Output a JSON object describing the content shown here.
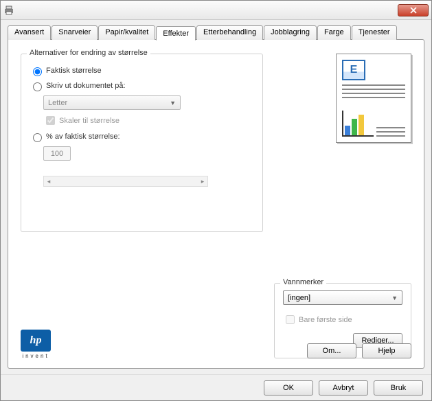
{
  "tabs": {
    "avansert": "Avansert",
    "snarveier": "Snarveier",
    "papir": "Papir/kvalitet",
    "effekter": "Effekter",
    "etterbehandling": "Etterbehandling",
    "jobblagring": "Jobblagring",
    "farge": "Farge",
    "tjenester": "Tjenester"
  },
  "resize_group": {
    "title": "Alternativer for endring av størrelse",
    "actual_size": "Faktisk størrelse",
    "print_on": "Skriv ut dokumentet på:",
    "paper_selected": "Letter",
    "scale_to_size": "Skaler til størrelse",
    "percent_actual": "% av faktisk størrelse:",
    "percent_value": "100"
  },
  "watermark_group": {
    "title": "Vannmerker",
    "selected": "[ingen]",
    "first_page_only": "Bare første side",
    "edit_button": "Rediger..."
  },
  "hp": {
    "invent": "invent"
  },
  "panel_buttons": {
    "about": "Om...",
    "help": "Hjelp"
  },
  "footer": {
    "ok": "OK",
    "cancel": "Avbryt",
    "apply": "Bruk"
  }
}
